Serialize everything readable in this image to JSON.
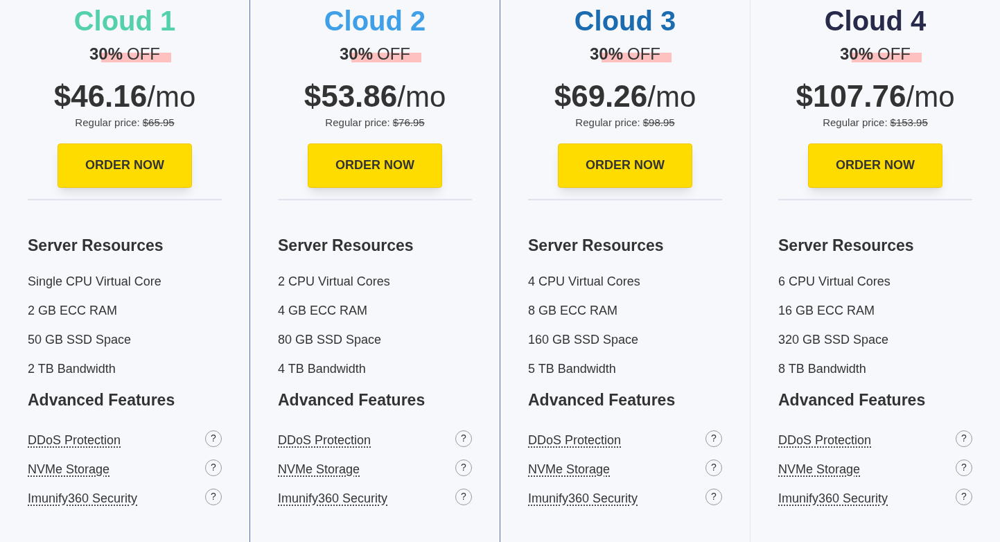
{
  "plans": [
    {
      "name": "Cloud 1",
      "color": "#55d0ac",
      "selected": false,
      "discount_percent": "30%",
      "discount_label": "OFF",
      "price": "$46.16",
      "period": "/mo",
      "regular_label": "Regular price:",
      "regular_price": "$65.95",
      "button": "ORDER NOW",
      "resources_title": "Server Resources",
      "resources": [
        "Single CPU Virtual Core",
        "2 GB ECC RAM",
        "50 GB SSD Space",
        "2 TB Bandwidth"
      ],
      "features_title": "Advanced Features",
      "features": [
        {
          "label": "DDoS Protection",
          "help": "?"
        },
        {
          "label": "NVMe Storage",
          "help": "?"
        },
        {
          "label": "Imunify360 Security",
          "help": "?"
        }
      ]
    },
    {
      "name": "Cloud 2",
      "color": "#3fa0e8",
      "selected": true,
      "discount_percent": "30%",
      "discount_label": "OFF",
      "price": "$53.86",
      "period": "/mo",
      "regular_label": "Regular price:",
      "regular_price": "$76.95",
      "button": "ORDER NOW",
      "resources_title": "Server Resources",
      "resources": [
        "2 CPU Virtual Cores",
        "4 GB ECC RAM",
        "80 GB SSD Space",
        "4 TB Bandwidth"
      ],
      "features_title": "Advanced Features",
      "features": [
        {
          "label": "DDoS Protection",
          "help": "?"
        },
        {
          "label": "NVMe Storage",
          "help": "?"
        },
        {
          "label": "Imunify360 Security",
          "help": "?"
        }
      ]
    },
    {
      "name": "Cloud 3",
      "color": "#1b6bb0",
      "selected": false,
      "discount_percent": "30%",
      "discount_label": "OFF",
      "price": "$69.26",
      "period": "/mo",
      "regular_label": "Regular price:",
      "regular_price": "$98.95",
      "button": "ORDER NOW",
      "resources_title": "Server Resources",
      "resources": [
        "4 CPU Virtual Cores",
        "8 GB ECC RAM",
        "160 GB SSD Space",
        "5 TB Bandwidth"
      ],
      "features_title": "Advanced Features",
      "features": [
        {
          "label": "DDoS Protection",
          "help": "?"
        },
        {
          "label": "NVMe Storage",
          "help": "?"
        },
        {
          "label": "Imunify360 Security",
          "help": "?"
        }
      ]
    },
    {
      "name": "Cloud 4",
      "color": "#272a4a",
      "selected": false,
      "discount_percent": "30%",
      "discount_label": "OFF",
      "price": "$107.76",
      "period": "/mo",
      "regular_label": "Regular price:",
      "regular_price": "$153.95",
      "button": "ORDER NOW",
      "resources_title": "Server Resources",
      "resources": [
        "6 CPU Virtual Cores",
        "16 GB ECC RAM",
        "320 GB SSD Space",
        "8 TB Bandwidth"
      ],
      "features_title": "Advanced Features",
      "features": [
        {
          "label": "DDoS Protection",
          "help": "?"
        },
        {
          "label": "NVMe Storage",
          "help": "?"
        },
        {
          "label": "Imunify360 Security",
          "help": "?"
        }
      ]
    }
  ]
}
